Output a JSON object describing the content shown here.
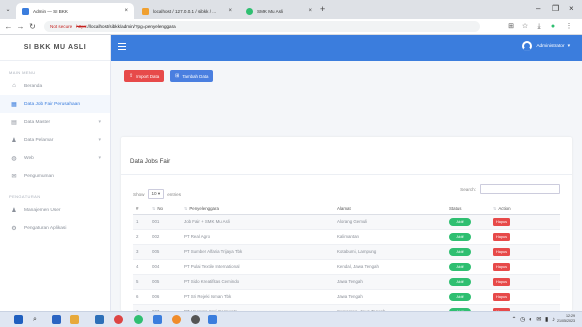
{
  "browser": {
    "tabs": [
      {
        "label": "Admin — SI BKK",
        "active": true
      },
      {
        "label": "localhost / 127.0.0.1 / sibkk / ... ",
        "active": false
      },
      {
        "label": "SMK Mu Asli",
        "active": false
      }
    ],
    "address": {
      "security_label": "Not secure",
      "strike_part": "https",
      "path": "://localhost/sibkk/admin/?pg=penyelenggara"
    }
  },
  "app": {
    "brand": "SI BKK MU ASLI",
    "sections": [
      {
        "heading": "MAIN MENU",
        "items": [
          {
            "label": "Beranda",
            "icon": "home-icon",
            "glyph": "⌂"
          },
          {
            "label": "Data Job Fair Perusahaan",
            "icon": "building-icon",
            "glyph": "▦",
            "active": true
          },
          {
            "label": "Data Master",
            "icon": "database-icon",
            "glyph": "▤",
            "arrow": true
          },
          {
            "label": "Data Pelamar",
            "icon": "users-icon",
            "glyph": "♟",
            "arrow": true
          },
          {
            "label": "Web",
            "icon": "globe-icon",
            "glyph": "◍",
            "arrow": true
          },
          {
            "label": "Pengumuman",
            "icon": "megaphone-icon",
            "glyph": "✉"
          }
        ]
      },
      {
        "heading": "PENGATURAN",
        "items": [
          {
            "label": "Manajemen User",
            "icon": "user-cog-icon",
            "glyph": "♟"
          },
          {
            "label": "Pengaturan Aplikasi",
            "icon": "gear-icon",
            "glyph": "⚙"
          }
        ]
      }
    ],
    "topbar": {
      "user": "Administrator"
    },
    "buttons": {
      "import": "Import Data",
      "add": "Tambah Data"
    },
    "card": {
      "title": "Data Jobs Fair",
      "show_label": "Show",
      "entries_value": "10",
      "entries_suffix": "entries",
      "search_label": "Search:"
    },
    "table": {
      "headers": [
        "#",
        "No",
        "Penyelenggara",
        "Alamat",
        "Status",
        "Action"
      ],
      "rows": [
        {
          "n": "1",
          "no": "001",
          "name": "Job Fair + SMK Mu Asli",
          "addr": "Alorang Gemuli",
          "status": "Aktif",
          "action": "Hapus"
        },
        {
          "n": "2",
          "no": "002",
          "name": "PT Real Agro",
          "addr": "Kalimantan",
          "status": "Aktif",
          "action": "Hapus"
        },
        {
          "n": "3",
          "no": "005",
          "name": "PT Sumber Alfaria Trijaya Tbk",
          "addr": "Kotabumi, Lampung",
          "status": "Aktif",
          "action": "Hapus"
        },
        {
          "n": "4",
          "no": "004",
          "name": "PT Pulai Textile International",
          "addr": "Kendal, Jawa Tengah",
          "status": "Aktif",
          "action": "Hapus"
        },
        {
          "n": "5",
          "no": "005",
          "name": "PT Sido Kreatifitas Cemindo",
          "addr": "Jawa Tengah",
          "status": "Aktif",
          "action": "Hapus"
        },
        {
          "n": "6",
          "no": "006",
          "name": "PT Sri Rejeki Isman Tbk",
          "addr": "Jawa Tengah",
          "status": "Aktif",
          "action": "Hapus"
        },
        {
          "n": "7",
          "no": "007",
          "name": "PT Ungaran Sari Garments",
          "addr": "Semarang, Jawa Tengah",
          "status": "Aktif",
          "action": "Hapus"
        },
        {
          "n": "8",
          "no": "008",
          "name": "LPK Kamasa Indonesia International",
          "addr": "Lampung",
          "status": "Aktif",
          "action": "Hapus"
        }
      ]
    }
  },
  "taskbar": {
    "time": "12:29",
    "date": "21/05/2023"
  },
  "colors": {
    "primary": "#3b7ddd",
    "danger": "#e74a4a",
    "success": "#2fbf71"
  }
}
